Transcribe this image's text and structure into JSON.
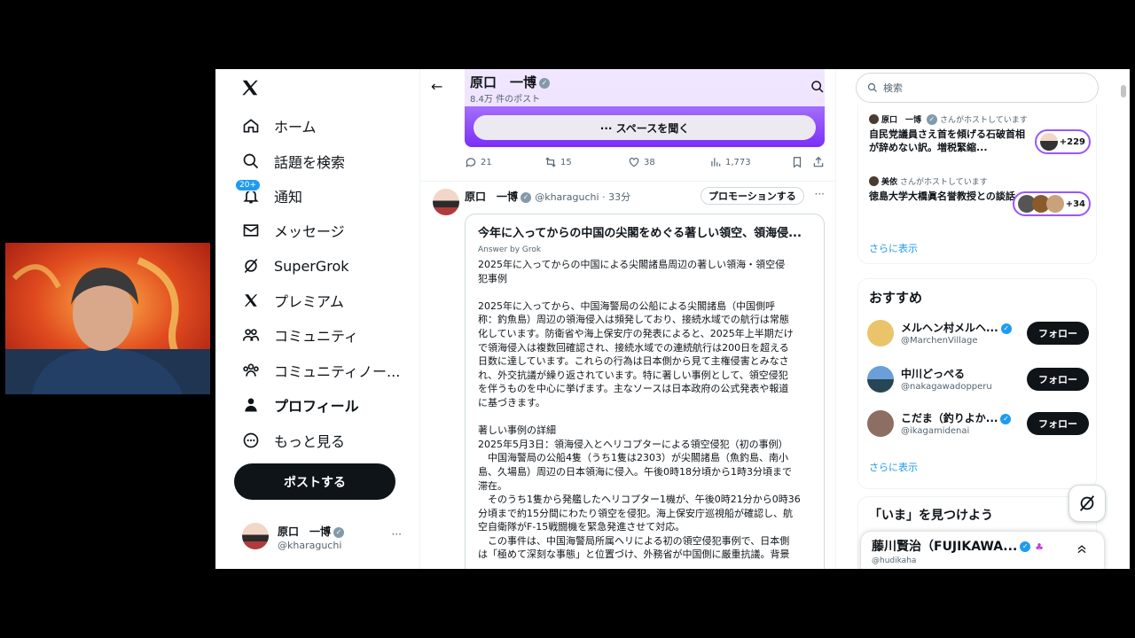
{
  "nav": {
    "items": [
      {
        "label": "ホーム",
        "icon": "home-icon"
      },
      {
        "label": "話題を検索",
        "icon": "search-icon"
      },
      {
        "label": "通知",
        "icon": "bell-icon",
        "badge": "20+"
      },
      {
        "label": "メッセージ",
        "icon": "mail-icon"
      },
      {
        "label": "SuperGrok",
        "icon": "grok-icon"
      },
      {
        "label": "プレミアム",
        "icon": "x-logo-icon"
      },
      {
        "label": "コミュニティ",
        "icon": "community-icon"
      },
      {
        "label": "コミュニティノー...",
        "icon": "community-notes-icon"
      },
      {
        "label": "プロフィール",
        "icon": "person-icon"
      },
      {
        "label": "もっと見る",
        "icon": "more-circle-icon"
      }
    ],
    "post_button": "ポストする",
    "me": {
      "name": "原口　一博",
      "handle": "@kharaguchi",
      "more": "···"
    }
  },
  "header": {
    "name": "原口　一博",
    "post_count": "8.4万 件のポスト",
    "back": "←"
  },
  "space": {
    "button": "··· スペースを聞く"
  },
  "actions": {
    "replies": "21",
    "reposts": "15",
    "likes": "38",
    "views": "1,773"
  },
  "tweet": {
    "name": "原口　一博",
    "handle": "@kharaguchi · 33分",
    "promote": "プロモーションする",
    "more": "···",
    "grok": {
      "title": "今年に入ってからの中国の尖閣をめぐる著しい領空、領海侵...",
      "subtitle": "Answer by Grok",
      "body": "2025年に入ってからの中国による尖閣諸島周辺の著しい領海・領空侵\n犯事例\n\n2025年に入ってから、中国海警局の公船による尖閣諸島（中国側呼\n称：釣魚島）周辺の領海侵入は頻発しており、接続水域での航行は常態\n化しています。防衛省や海上保安庁の発表によると、2025年上半期だけ\nで領海侵入は複数回確認され、接続水域での連続航行は200日を超える\n日数に達しています。これらの行為は日本側から見て主権侵害とみなさ\nれ、外交抗議が繰り返されています。特に著しい事例として、領空侵犯\nを伴うものを中心に挙げます。主なソースは日本政府の公式発表や報道\nに基づきます。\n\n著しい事例の詳細\n2025年5月3日：領海侵入とヘリコプターによる領空侵犯（初の事例）\n　中国海警局の公船4隻（うち1隻は2303）が尖閣諸島（魚釣島、南小\n島、久場島）周辺の日本領海に侵入。午後0時18分頃から1時3分頃まで\n滞在。\n　そのうち1隻から発艦したヘリコプター1機が、午後0時21分から0時36\n分頃まで約15分間にわたり領空を侵犯。海上保安庁巡視船が確認し、航\n空自衛隊がF-15戦闘機を緊急発進させて対応。\n　この事件は、中国海警局所属ヘリによる初の領空侵犯事例で、日本側\nは「極めて深刻な事態」と位置づけ、外務省が中国側に厳重抗議。背景"
    }
  },
  "right": {
    "search_placeholder": "検索",
    "spaces": [
      {
        "host": "原口　一博",
        "host_suffix": "さんがホストしています",
        "title": "自民党議員さえ首を傾げる石破首相が辞めない訳。増税緊縮...",
        "count": "+229"
      },
      {
        "host": "美依",
        "host_suffix": "さんがホストしています",
        "title": "徳島大学大橋眞名誉教授との談話",
        "count": "+34"
      }
    ],
    "spaces_more": "さらに表示",
    "recommend_title": "おすすめ",
    "recommend": [
      {
        "name": "メルヘン村メルヘ...",
        "handle": "@MarchenVillage",
        "follow": "フォロー",
        "color": "#e9c46a"
      },
      {
        "name": "中川どっぺる",
        "handle": "@nakagawadopperu",
        "follow": "フォロー",
        "color": "#264653"
      },
      {
        "name": "こだま（釣りよか...",
        "handle": "@ikagamidenai",
        "follow": "フォロー",
        "color": "#8d6e63"
      }
    ],
    "recommend_more": "さらに表示",
    "now_title": "「いま」を見つけよう",
    "float": {
      "name": "藤川賢治（FUJIKAWA...",
      "handle": "@hudikaha"
    }
  }
}
